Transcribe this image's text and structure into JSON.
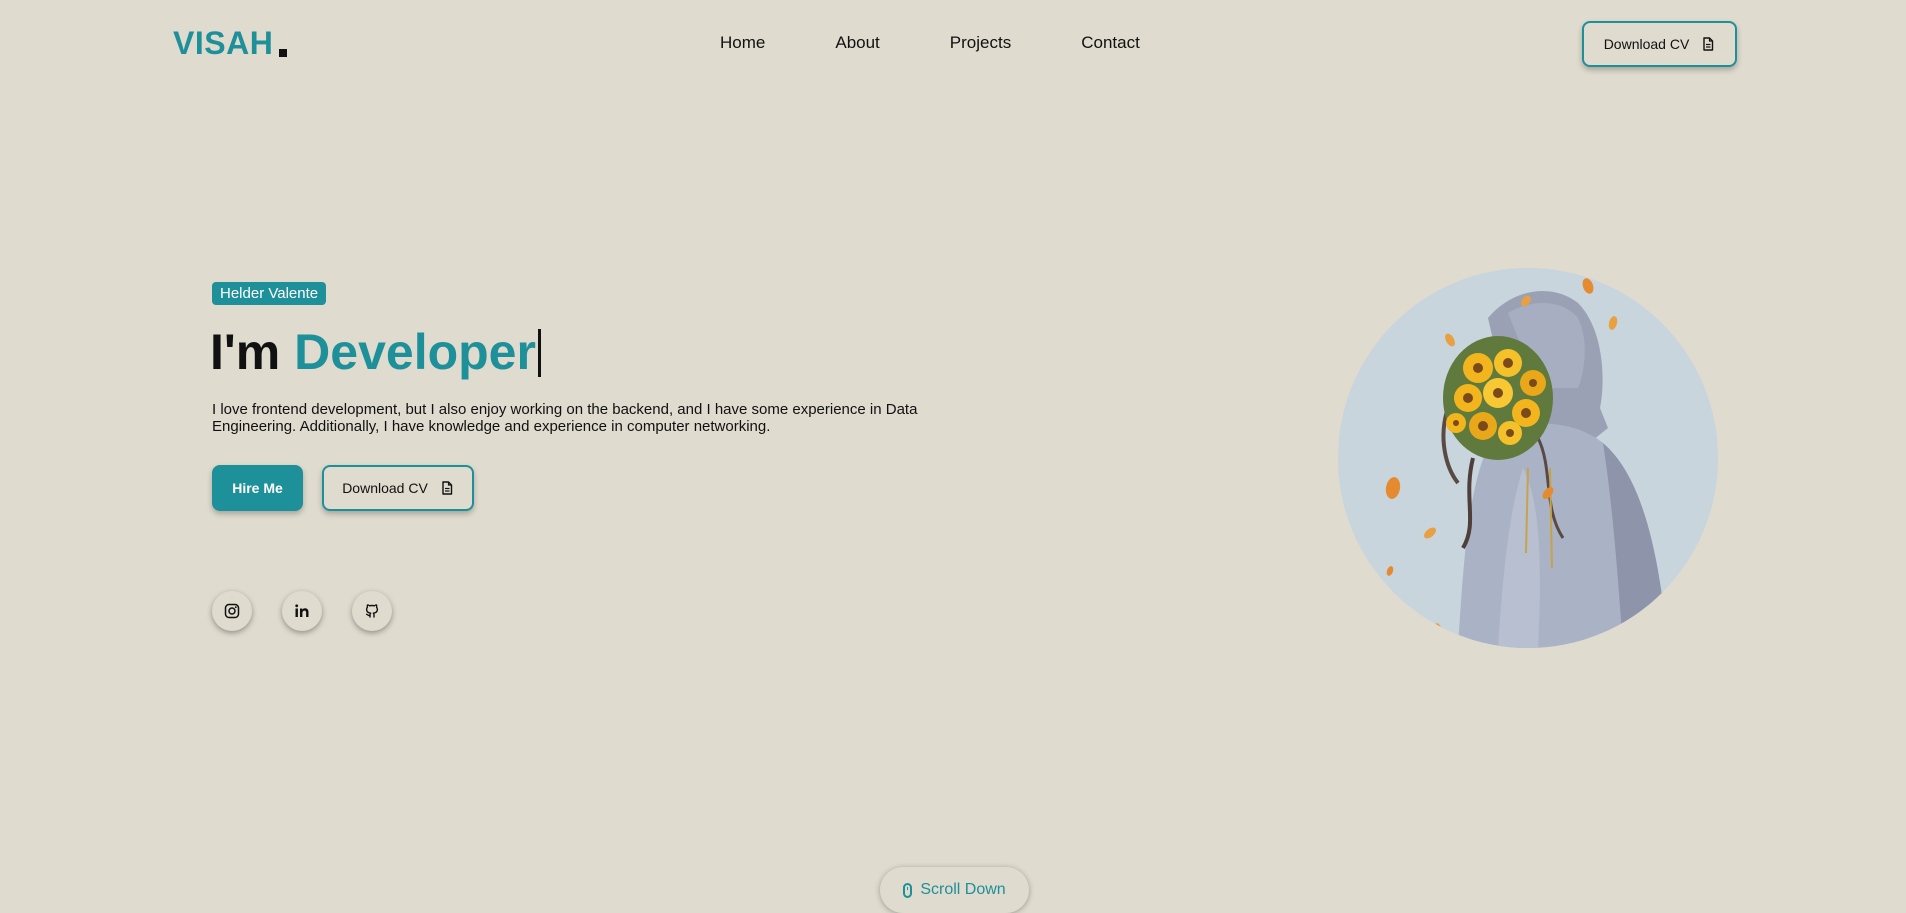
{
  "header": {
    "logo": "VISAH",
    "nav": [
      "Home",
      "About",
      "Projects",
      "Contact"
    ],
    "cv_button_label": "Download CV"
  },
  "hero": {
    "name_badge": "Helder Valente",
    "headline_prefix": "I'm",
    "headline_role": "Developer",
    "intro": "I love frontend development, but I also enjoy working on the backend, and I have some experience in Data Engineering. Additionally, I have knowledge and experience in computer networking.",
    "hire_button_label": "Hire Me",
    "cv_button_label": "Download CV",
    "social_icons": [
      "instagram-icon",
      "linkedin-icon",
      "github-icon"
    ]
  },
  "scroll": {
    "label": "Scroll Down"
  },
  "colors": {
    "background": "#dfdbcf",
    "accent": "#1e9099",
    "text": "#111111",
    "portrait_bg": "#c9d5dd"
  }
}
